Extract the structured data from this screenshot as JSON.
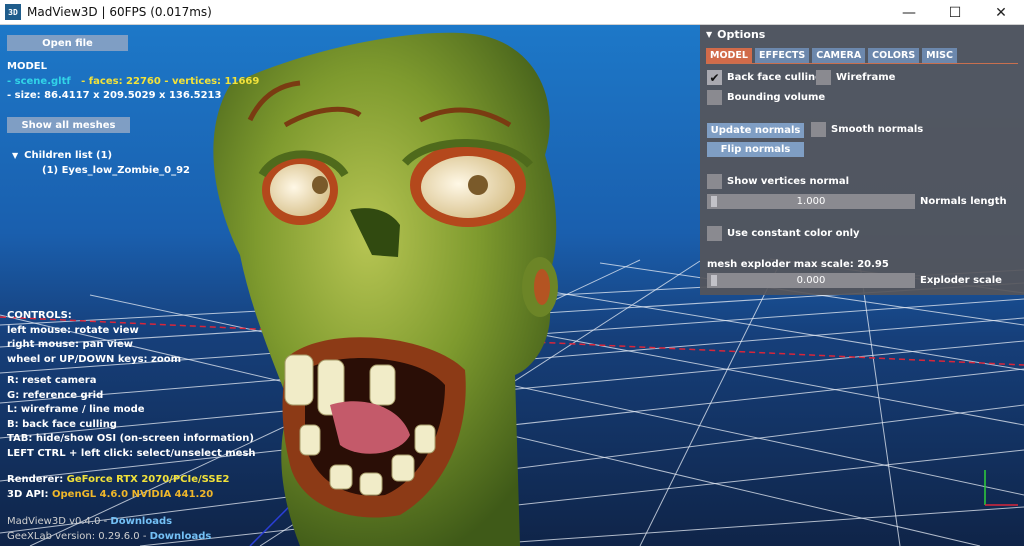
{
  "window": {
    "title": "MadView3D | 60FPS (0.017ms)",
    "icon_text": "3D",
    "minimize_glyph": "—",
    "maximize_glyph": "☐",
    "close_glyph": "✕"
  },
  "left_panel": {
    "open_file_label": "Open file",
    "model_heading": "MODEL",
    "scene_file": "- scene.gltf",
    "faces_vertices": "- faces: 22760 - vertices: 11669",
    "size": "- size:  86.4117 x 209.5029 x 136.5213",
    "show_all_meshes_label": "Show all meshes",
    "children_list": "Children list (1)",
    "children": [
      "(1) Eyes_low_Zombie_0_92"
    ]
  },
  "controls": {
    "heading": "CONTROLS:",
    "lines_a": [
      "left mouse: rotate view",
      "right mouse: pan view",
      "wheel or UP/DOWN keys: zoom"
    ],
    "lines_b": [
      "R: reset camera",
      "G: reference grid",
      "L: wireframe / line mode",
      "B: back face culling",
      "TAB: hide/show OSI (on-screen information)",
      "LEFT CTRL + left click: select/unselect mesh"
    ]
  },
  "renderer": {
    "renderer_label": "Renderer: ",
    "renderer_value": "GeForce RTX 2070/PCIe/SSE2",
    "api_label": "3D API: ",
    "api_value": "OpenGL 4.6.0 NVIDIA 441.20"
  },
  "footer": {
    "madview_version": "MadView3D v0.4.0 - ",
    "madview_link": "Downloads",
    "geexlab_version": "GeeXLab version: 0.29.6.0 - ",
    "geexlab_link": "Downloads"
  },
  "options": {
    "title": "Options",
    "tabs": [
      {
        "label": "MODEL",
        "active": true
      },
      {
        "label": "EFFECTS",
        "active": false
      },
      {
        "label": "CAMERA",
        "active": false
      },
      {
        "label": "COLORS",
        "active": false
      },
      {
        "label": "MISC",
        "active": false
      }
    ],
    "back_face_culling": {
      "label": "Back face culling",
      "checked": true
    },
    "wireframe": {
      "label": "Wireframe",
      "checked": false
    },
    "bounding_volume": {
      "label": "Bounding volume",
      "checked": false
    },
    "update_normals_label": "Update normals",
    "smooth_normals": {
      "label": "Smooth normals",
      "checked": false
    },
    "flip_normals_label": "Flip normals",
    "show_vertices_normal": {
      "label": "Show vertices normal",
      "checked": false
    },
    "normals_length": {
      "value": "1.000",
      "label": "Normals length"
    },
    "use_constant_color": {
      "label": "Use constant color only",
      "checked": false
    },
    "mesh_exploder_label": "mesh exploder max scale: 20.95",
    "exploder_scale": {
      "value": "0.000",
      "label": "Exploder scale"
    }
  },
  "colors": {
    "tab_active": "#d16b4a",
    "button": "#7f9ec4",
    "panel": "#55555a",
    "highlight_cyan": "#31d4e8",
    "highlight_yellow": "#f2e23a",
    "link": "#74c0f5"
  },
  "icons": {
    "app": "app-logo-icon",
    "check": "checkmark-icon",
    "tree_toggle": "triangle-down-icon"
  }
}
